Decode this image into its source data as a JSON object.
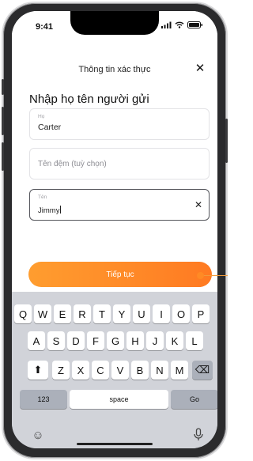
{
  "status_bar": {
    "time": "9:41"
  },
  "header": {
    "title": "Thông tin xác thực",
    "close": "✕"
  },
  "form": {
    "title": "Nhập họ tên người gửi",
    "last_name": {
      "label": "Họ",
      "value": "Carter"
    },
    "middle_name": {
      "placeholder": "Tên đệm (tuỳ chọn)"
    },
    "first_name": {
      "label": "Tên",
      "value": "Jimmy",
      "clear": "✕"
    }
  },
  "continue_button": {
    "label": "Tiếp tục"
  },
  "keyboard": {
    "row1": [
      "Q",
      "W",
      "E",
      "R",
      "T",
      "Y",
      "U",
      "I",
      "O",
      "P"
    ],
    "row2": [
      "A",
      "S",
      "D",
      "F",
      "G",
      "H",
      "J",
      "K",
      "L"
    ],
    "row3": [
      "Z",
      "X",
      "C",
      "V",
      "B",
      "N",
      "M"
    ],
    "numbers_key": "123",
    "space_key": "space",
    "go_key": "Go",
    "shift_icon": "⬆",
    "delete_icon": "⌫",
    "emoji_icon": "☺"
  },
  "colors": {
    "accent": "#ff8a25",
    "keyboard_bg": "#d1d3d9"
  }
}
